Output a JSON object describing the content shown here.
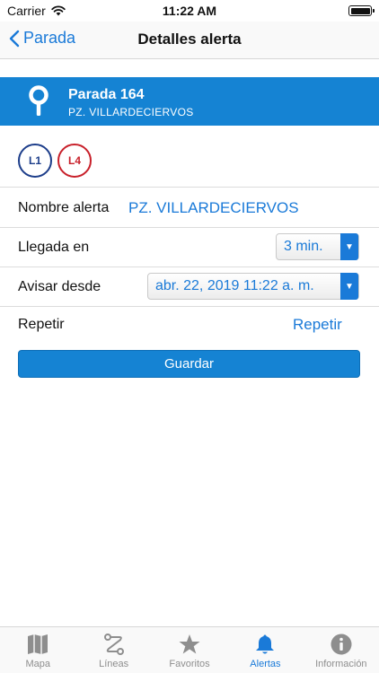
{
  "status_bar": {
    "carrier": "Carrier",
    "time": "11:22 AM"
  },
  "nav": {
    "back_label": "Parada",
    "title": "Detalles alerta"
  },
  "stop": {
    "name": "Parada 164",
    "address": "PZ. VILLARDECIERVOS"
  },
  "lines": [
    {
      "label": "L1",
      "color": "#1c3d8a"
    },
    {
      "label": "L4",
      "color": "#c8202a"
    }
  ],
  "form": {
    "name_label": "Nombre alerta",
    "name_value": "PZ. VILLARDECIERVOS",
    "arrival_label": "Llegada en",
    "arrival_value": "3 min.",
    "notify_label": "Avisar desde",
    "notify_value": "abr. 22, 2019 11:22 a. m.",
    "repeat_label": "Repetir",
    "repeat_value": "Repetir",
    "save_label": "Guardar"
  },
  "tabs": [
    {
      "label": "Mapa",
      "icon": "map-icon",
      "active": false
    },
    {
      "label": "Líneas",
      "icon": "route-icon",
      "active": false
    },
    {
      "label": "Favoritos",
      "icon": "star-icon",
      "active": false
    },
    {
      "label": "Alertas",
      "icon": "bell-icon",
      "active": true
    },
    {
      "label": "Información",
      "icon": "info-icon",
      "active": false
    }
  ],
  "colors": {
    "accent": "#1a7ad8",
    "banner": "#1583d3"
  }
}
